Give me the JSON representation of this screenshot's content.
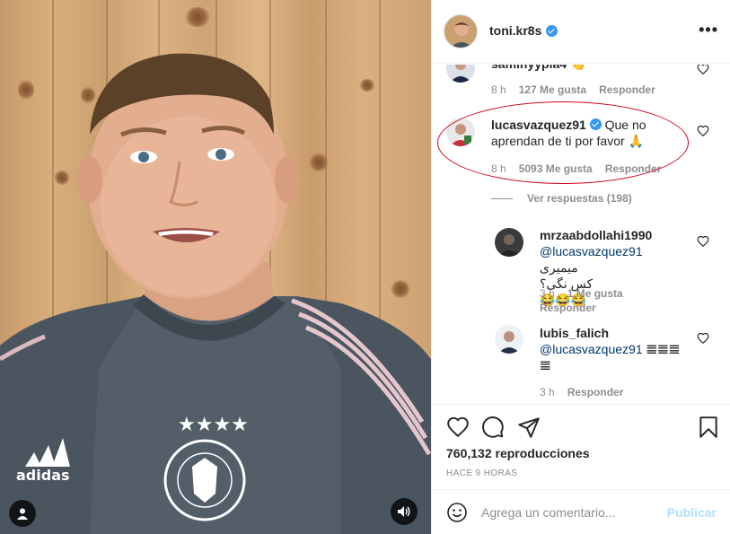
{
  "header": {
    "username": "toni.kr8s",
    "verified_icon": "verified-badge-icon",
    "more_icon": "more-options-icon",
    "more_label": "•••"
  },
  "comments": [
    {
      "username": "saminyypia4",
      "text": "👏",
      "time": "8 h",
      "likes": "127 Me gusta",
      "reply": "Responder"
    },
    {
      "username": "lucasvazquez91",
      "verified": true,
      "text": "Que no aprendan de ti por favor 🙏",
      "time": "8 h",
      "likes": "5093 Me gusta",
      "reply": "Responder",
      "view_replies": "Ver respuestas (198)"
    },
    {
      "username": "mrzaabdollahi1990",
      "mention": "@lucasvazquez91",
      "text_line1": "میمیری",
      "text_line2": "کس نگی؟😂😂😂",
      "time": "3 h",
      "likes": "1 Me gusta",
      "reply": "Responder"
    },
    {
      "username": "lubis_falich",
      "mention": "@lucasvazquez91",
      "text": "𝌆𝌆𝌆 𝌆",
      "time": "3 h",
      "reply": "Responder"
    }
  ],
  "actions": {
    "like_icon": "heart-icon",
    "comment_icon": "comment-icon",
    "share_icon": "share-icon",
    "save_icon": "bookmark-icon",
    "views": "760,132 reproducciones",
    "posted": "HACE 9 HORAS"
  },
  "add_comment": {
    "placeholder": "Agrega un comentario...",
    "publish": "Publicar",
    "emoji_icon": "emoji-icon"
  },
  "colors": {
    "accent": "#0095f6",
    "publish_disabled": "#b2dffc",
    "annotation": "#d0021b",
    "muted": "#8e8e8e"
  }
}
